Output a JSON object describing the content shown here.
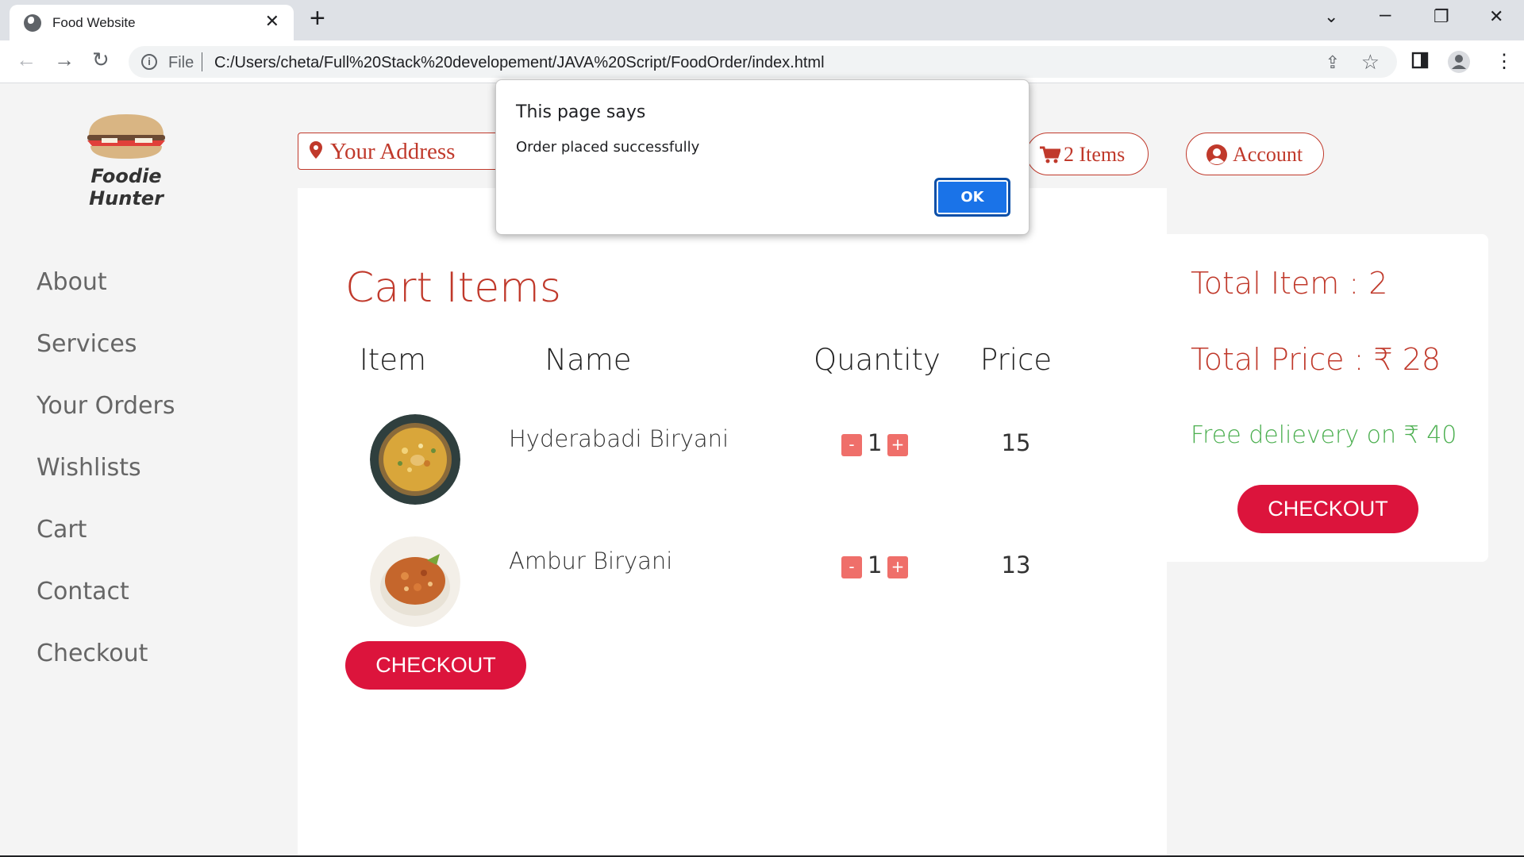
{
  "browser": {
    "tab_title": "Food Website",
    "new_tab": "+",
    "close_tab": "✕",
    "file_label": "File",
    "url": "C:/Users/cheta/Full%20Stack%20developement/JAVA%20Script/FoodOrder/index.html",
    "info_glyph": "i"
  },
  "header": {
    "logo_text": "Foodie Hunter",
    "address_placeholder": "Your Address",
    "cart_label": "2 Items",
    "account_label": "Account"
  },
  "sidebar": {
    "items": [
      {
        "label": "About"
      },
      {
        "label": "Services"
      },
      {
        "label": "Your Orders"
      },
      {
        "label": "Wishlists"
      },
      {
        "label": "Cart"
      },
      {
        "label": "Contact"
      },
      {
        "label": "Checkout"
      }
    ]
  },
  "cart": {
    "title": "Cart Items",
    "columns": [
      "Item",
      "Name",
      "Quantity",
      "Price"
    ],
    "rows": [
      {
        "name": "Hyderabadi Biryani",
        "quantity": "1",
        "price": "15",
        "minus": "-",
        "plus": "+"
      },
      {
        "name": "Ambur Biryani",
        "quantity": "1",
        "price": "13",
        "minus": "-",
        "plus": "+"
      }
    ],
    "checkout_label": "CHECKOUT"
  },
  "summary": {
    "total_items": "Total Item : 2",
    "total_price": "Total Price : ₹ 28",
    "free_delivery": "Free delievery on ₹ 40",
    "checkout_label": "CHECKOUT"
  },
  "dialog": {
    "title": "This page says",
    "message": "Order placed successfully",
    "ok_label": "OK"
  },
  "colors": {
    "accent": "#c0392b",
    "checkout": "#dc143c",
    "free_delivery": "#4caf50",
    "qty_button": "#ef6f6a",
    "dialog_button": "#1a73e8"
  }
}
